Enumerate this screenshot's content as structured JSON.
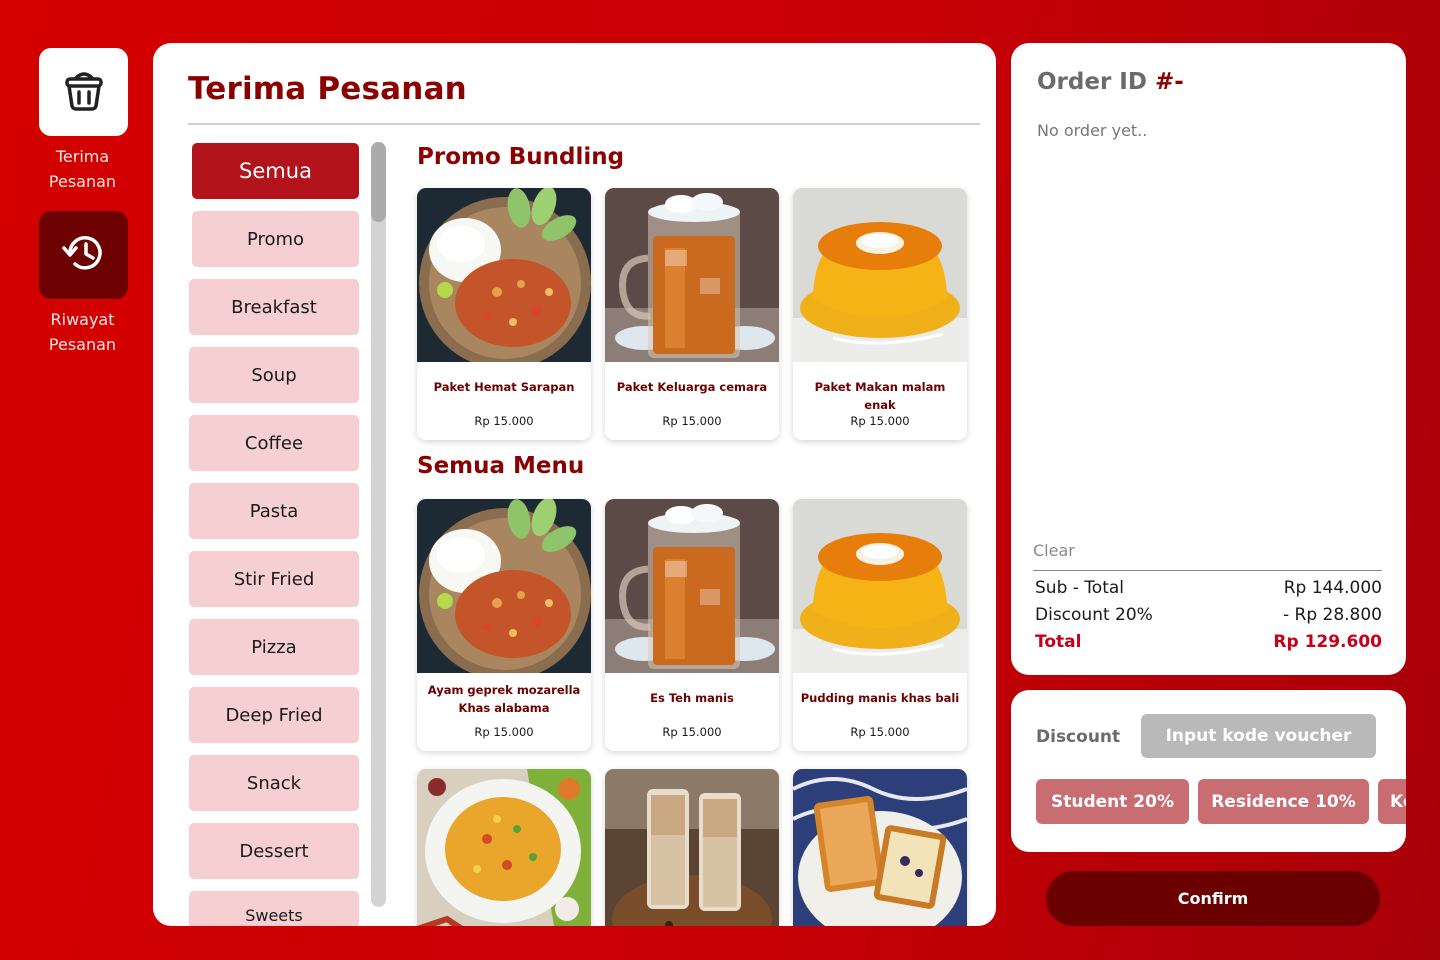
{
  "colors": {
    "background": "#cc0000",
    "accent": "#8b0000",
    "category_active": "#b3141b",
    "category_idle": "#f5cfd2",
    "chip": "#c86e73",
    "total": "#c4001a"
  },
  "nav": [
    {
      "label": "Terima\nPesanan",
      "icon": "basket-icon",
      "active": true
    },
    {
      "label": "Riwayat\nPesanan",
      "icon": "history-icon",
      "active": false
    }
  ],
  "main": {
    "title": "Terima Pesanan",
    "categories": [
      "Semua",
      "Promo",
      "Breakfast",
      "Soup",
      "Coffee",
      "Pasta",
      "Stir Fried",
      "Pizza",
      "Deep Fried",
      "Snack",
      "Dessert",
      "Sweets"
    ],
    "active_category": "Semua",
    "promo_title": "Promo Bundling",
    "promo_items": [
      {
        "name": "Paket Hemat Sarapan",
        "price": "Rp 15.000",
        "image": "rice-chicken-image"
      },
      {
        "name": "Paket Keluarga cemara",
        "price": "Rp 15.000",
        "image": "iced-tea-image"
      },
      {
        "name": "Paket Makan malam enak",
        "price": "Rp 15.000",
        "image": "pudding-image"
      }
    ],
    "menu_title": "Semua Menu",
    "menu_items": [
      {
        "name": "Ayam geprek mozarella Khas alabama",
        "price": "Rp 15.000",
        "image": "rice-chicken-image"
      },
      {
        "name": "Es Teh manis",
        "price": "Rp 15.000",
        "image": "iced-tea-image"
      },
      {
        "name": "Pudding manis khas bali",
        "price": "Rp 15.000",
        "image": "pudding-image"
      },
      {
        "image": "fried-rice-image"
      },
      {
        "image": "latte-image"
      },
      {
        "image": "toast-image"
      }
    ]
  },
  "order": {
    "title": "Order ID",
    "id": "#-",
    "empty_message": "No order yet..",
    "clear_label": "Clear",
    "subtotal_label": "Sub - Total",
    "subtotal_value": "Rp 144.000",
    "discount_label": "Discount 20%",
    "discount_value": "- Rp 28.800",
    "total_label": "Total",
    "total_value": "Rp 129.600"
  },
  "discount": {
    "label": "Discount",
    "input_placeholder": "Input kode voucher",
    "chips": [
      "Student 20%",
      "Residence 10%",
      "Ko"
    ]
  },
  "confirm_label": "Confirm"
}
